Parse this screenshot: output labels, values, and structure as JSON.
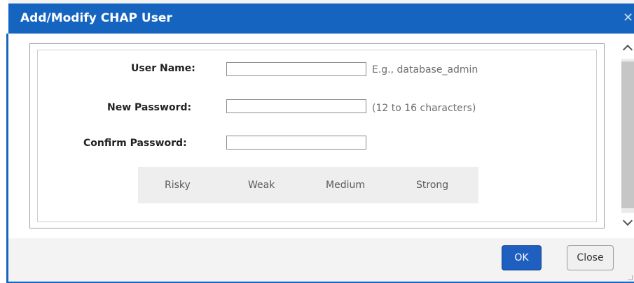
{
  "dialog": {
    "title": "Add/Modify CHAP User",
    "close_icon": "close-icon",
    "fields": {
      "user_name": {
        "label": "User Name:",
        "value": "",
        "hint": "E.g., database_admin"
      },
      "new_password": {
        "label": "New Password:",
        "value": "",
        "hint": "(12 to 16 characters)"
      },
      "confirm_password": {
        "label": "Confirm Password:",
        "value": ""
      }
    },
    "strength": {
      "levels": [
        "Risky",
        "Weak",
        "Medium",
        "Strong"
      ]
    },
    "buttons": {
      "ok": "OK",
      "close": "Close"
    }
  },
  "colors": {
    "title_bar": "#1565c0",
    "ok_button": "#1e5fbf",
    "strength_background": "#eeeeee"
  }
}
